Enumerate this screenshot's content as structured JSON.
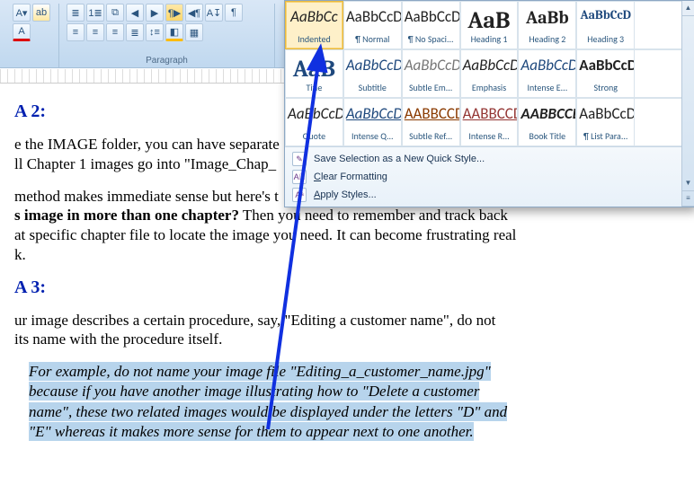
{
  "ribbon": {
    "paragraph_label": "Paragraph"
  },
  "styles": {
    "row1": [
      {
        "preview": "AaBbCc",
        "name": "Indented",
        "cls": "italic",
        "selected": true
      },
      {
        "preview": "AaBbCcDd",
        "name": "¶ Normal",
        "cls": ""
      },
      {
        "preview": "AaBbCcDd",
        "name": "¶ No Spaci...",
        "cls": ""
      },
      {
        "preview": "AaB",
        "name": "Heading 1",
        "cls": "big"
      },
      {
        "preview": "AaBb",
        "name": "Heading 2",
        "cls": "h2"
      },
      {
        "preview": "AaBbCcD",
        "name": "Heading 3",
        "cls": "h3"
      }
    ],
    "row2": [
      {
        "preview": "AaB",
        "name": "Title",
        "cls": "blue big"
      },
      {
        "preview": "AaBbCcDd",
        "name": "Subtitle",
        "cls": "blue italic"
      },
      {
        "preview": "AaBbCcDd",
        "name": "Subtle Em...",
        "cls": "italic",
        "style": "color:#777"
      },
      {
        "preview": "AaBbCcDd",
        "name": "Emphasis",
        "cls": "italic"
      },
      {
        "preview": "AaBbCcDd",
        "name": "Intense E...",
        "cls": "italic blue"
      },
      {
        "preview": "AaBbCcDd",
        "name": "Strong",
        "cls": "",
        "style": "font-weight:bold"
      }
    ],
    "row3": [
      {
        "preview": "AaBbCcDd",
        "name": "Quote",
        "cls": "italic"
      },
      {
        "preview": "AaBbCcDd",
        "name": "Intense Q...",
        "cls": "italic blue",
        "style": "text-decoration:underline"
      },
      {
        "preview": "AABBCCDD",
        "name": "Subtle Ref...",
        "cls": "caps underline"
      },
      {
        "preview": "AABBCCDD",
        "name": "Intense R...",
        "cls": "caps red",
        "style": "text-decoration:underline"
      },
      {
        "preview": "AABBCCDD",
        "name": "Book Title",
        "cls": "caps italic",
        "style": "font-weight:bold"
      },
      {
        "preview": "AaBbCcDd",
        "name": "¶ List Para...",
        "cls": ""
      }
    ],
    "menu": {
      "save": "Save Selection as a New Quick Style...",
      "clear": "Clear Formatting",
      "apply": "Apply Styles..."
    }
  },
  "doc": {
    "hA": "A 2:",
    "p1a": "e the IMAGE folder, you can have separate",
    "p1b": "ll Chapter 1 images go into \"Image_Chap_",
    "p2a": "method makes immediate sense but here's t",
    "p2b": "s image in more than one chapter?",
    "p2c": " Then you need to remember and track back",
    "p2d": "at specific chapter file to locate the image you need. It can become frustrating real",
    "p2e": "k.",
    "hB": "A 3:",
    "p3a": "ur image describes a certain procedure, say, \"Editing a customer name\", do not",
    "p3b": "its name with the procedure itself.",
    "hl1": "For example, do not name your image file \"Editing_a_customer_name.jpg\"",
    "hl2": "because if you have another image illustrating how to \"Delete a customer",
    "hl3": "name\", these two related images would be displayed under the letters \"D\" and",
    "hl4": "\"E\" whereas it makes more sense for them to appear next to one another."
  }
}
